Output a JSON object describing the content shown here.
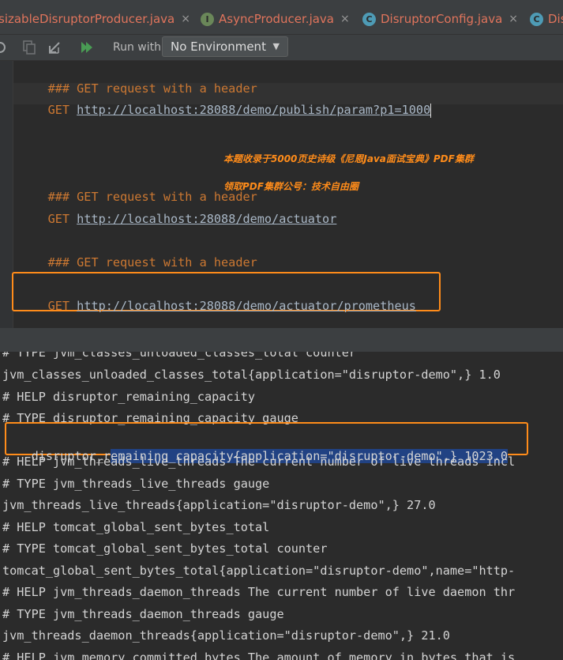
{
  "tabs": [
    {
      "label": "sizableDisruptorProducer.java",
      "close": "×"
    },
    {
      "label": "AsyncProducer.java",
      "icon_letter": "I",
      "icon_color": "#6a8759",
      "close": "×"
    },
    {
      "label": "DisruptorConfig.java",
      "icon_letter": "C",
      "icon_color": "#4e9bb5",
      "close": "×"
    },
    {
      "label": "Dis",
      "icon_letter": "C",
      "icon_color": "#4e9bb5"
    }
  ],
  "toolbar": {
    "run_with_label": "Run with:",
    "environment": "No Environment",
    "icons": [
      "copy-icon",
      "import-icon",
      "run-all-icon"
    ]
  },
  "editor": {
    "line1": {
      "comment": "### GET request with a header"
    },
    "line2": {
      "method": "GET",
      "url": "http://localhost:28088/demo/publish/param?p1=1000"
    },
    "line3": {
      "comment": "### GET request with a header"
    },
    "line4": {
      "method": "GET",
      "url": "http://localhost:28088/demo/actuator"
    },
    "line5": {
      "comment": "### GET request with a header"
    },
    "line6": {
      "method": "GET",
      "url": "http://localhost:28088/demo/actuator/prometheus"
    },
    "watermark1": "本题收录于5000页史诗级《尼恩Java面试宝典》PDF集群",
    "watermark2": "领取PDF集群公号：技术自由圈"
  },
  "response": {
    "partial_top": "# TYPE jvm_classes_unloaded_classes_total counter",
    "lines": [
      "jvm_classes_unloaded_classes_total{application=\"disruptor-demo\",} 1.0",
      "# HELP disruptor_remaining_capacity",
      "# TYPE disruptor_remaining_capacity gauge"
    ],
    "selected_line": {
      "before": "disruptor_r",
      "selected": "emaining_capacity{application=\"disruptor-demo\",} 1023.0"
    },
    "lines_after": [
      "# HELP jvm_threads_live_threads The current number of live threads incl",
      "# TYPE jvm_threads_live_threads gauge",
      "jvm_threads_live_threads{application=\"disruptor-demo\",} 27.0",
      "# HELP tomcat_global_sent_bytes_total",
      "# TYPE tomcat_global_sent_bytes_total counter",
      "tomcat_global_sent_bytes_total{application=\"disruptor-demo\",name=\"http-",
      "# HELP jvm_threads_daemon_threads The current number of live daemon thr",
      "# TYPE jvm_threads_daemon_threads gauge",
      "jvm_threads_daemon_threads{application=\"disruptor-demo\",} 21.0"
    ],
    "partial_bottom": "# HELP jvm_memory_committed_bytes The amount of memory in bytes that is"
  }
}
